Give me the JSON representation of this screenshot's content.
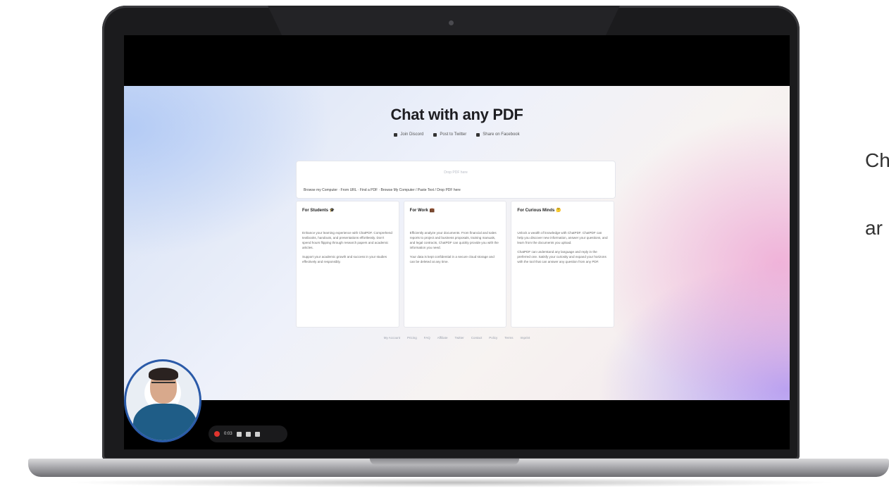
{
  "app": {
    "title": "Chat with any PDF",
    "links": [
      "Join Discord",
      "Post to Twitter",
      "Share on Facebook"
    ],
    "drop_label": "Drop PDF here",
    "drop_text": "Browse my Computer · From URL · Find a PDF · Browse My Computer / Paste Text / Drop PDF here",
    "cards": [
      {
        "title": "For Students 🎓",
        "paras": [
          "Enhance your learning experience with ChatPDF. Comprehend textbooks, handouts, and presentations effortlessly. Don't spend hours flipping through research papers and academic articles.",
          "Support your academic growth and success in your studies effectively and responsibly."
        ]
      },
      {
        "title": "For Work 💼",
        "paras": [
          "Efficiently analyze your documents. From financial and sales reports to project and business proposals, training manuals, and legal contracts, ChatPDF can quickly provide you with the information you need.",
          "Your data is kept confidential in a secure cloud storage and can be deleted at any time."
        ]
      },
      {
        "title": "For Curious Minds 🤔",
        "paras": [
          "Unlock a wealth of knowledge with ChatPDF. ChatPDF can help you discover new information, answer your questions, and learn from the documents you upload.",
          "ChatPDF can understand any language and reply in the preferred one. Satisfy your curiosity and expand your horizons with the tool that can answer any question from any PDF."
        ]
      }
    ],
    "footer": [
      "My Account",
      "Pricing",
      "FAQ",
      "Affiliate",
      "Twitter",
      "Contact",
      "Policy",
      "Terms",
      "Imprint"
    ]
  },
  "recorder": {
    "time": "0:03"
  },
  "side_text": [
    "Ch",
    "ar"
  ]
}
